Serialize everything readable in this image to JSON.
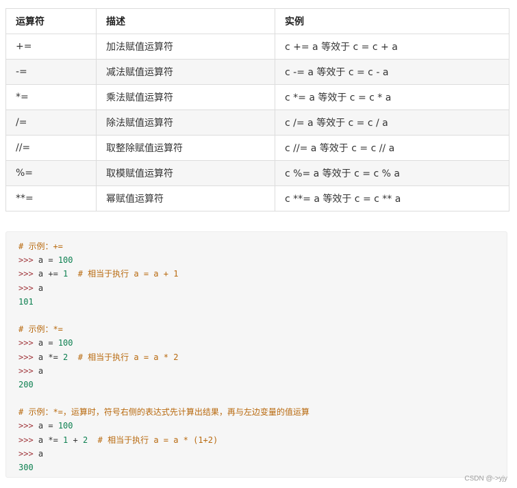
{
  "table": {
    "headers": [
      "运算符",
      "描述",
      "实例"
    ],
    "rows": [
      [
        "+=",
        "加法赋值运算符",
        "c += a 等效于 c = c + a"
      ],
      [
        "-=",
        "减法赋值运算符",
        "c -= a 等效于 c = c - a"
      ],
      [
        "*=",
        "乘法赋值运算符",
        "c *= a 等效于 c = c * a"
      ],
      [
        "/=",
        "除法赋值运算符",
        "c /= a 等效于 c = c / a"
      ],
      [
        "//=",
        "取整除赋值运算符",
        "c //= a 等效于 c = c // a"
      ],
      [
        "%=",
        "取模赋值运算符",
        "c %= a 等效于 c = c % a"
      ],
      [
        "**=",
        "幂赋值运算符",
        "c **= a 等效于 c = c ** a"
      ]
    ]
  },
  "code": {
    "lines": [
      [
        {
          "t": "cm",
          "v": "# 示例：+="
        }
      ],
      [
        {
          "t": "pr",
          "v": ">>> "
        },
        {
          "t": "tx",
          "v": "a = "
        },
        {
          "t": "num",
          "v": "100"
        }
      ],
      [
        {
          "t": "pr",
          "v": ">>> "
        },
        {
          "t": "tx",
          "v": "a += "
        },
        {
          "t": "num",
          "v": "1"
        },
        {
          "t": "tx",
          "v": "  "
        },
        {
          "t": "cm",
          "v": "# 相当于执行 a = a + 1"
        }
      ],
      [
        {
          "t": "pr",
          "v": ">>> "
        },
        {
          "t": "tx",
          "v": "a"
        }
      ],
      [
        {
          "t": "out",
          "v": "101"
        }
      ],
      [],
      [
        {
          "t": "cm",
          "v": "# 示例：*="
        }
      ],
      [
        {
          "t": "pr",
          "v": ">>> "
        },
        {
          "t": "tx",
          "v": "a = "
        },
        {
          "t": "num",
          "v": "100"
        }
      ],
      [
        {
          "t": "pr",
          "v": ">>> "
        },
        {
          "t": "tx",
          "v": "a *= "
        },
        {
          "t": "num",
          "v": "2"
        },
        {
          "t": "tx",
          "v": "  "
        },
        {
          "t": "cm",
          "v": "# 相当于执行 a = a * 2"
        }
      ],
      [
        {
          "t": "pr",
          "v": ">>> "
        },
        {
          "t": "tx",
          "v": "a"
        }
      ],
      [
        {
          "t": "out",
          "v": "200"
        }
      ],
      [],
      [
        {
          "t": "cm",
          "v": "# 示例：*=，运算时，符号右侧的表达式先计算出结果，再与左边变量的值运算"
        }
      ],
      [
        {
          "t": "pr",
          "v": ">>> "
        },
        {
          "t": "tx",
          "v": "a = "
        },
        {
          "t": "num",
          "v": "100"
        }
      ],
      [
        {
          "t": "pr",
          "v": ">>> "
        },
        {
          "t": "tx",
          "v": "a *= "
        },
        {
          "t": "num",
          "v": "1"
        },
        {
          "t": "tx",
          "v": " + "
        },
        {
          "t": "num",
          "v": "2"
        },
        {
          "t": "tx",
          "v": "  "
        },
        {
          "t": "cm",
          "v": "# 相当于执行 a = a * (1+2)"
        }
      ],
      [
        {
          "t": "pr",
          "v": ">>> "
        },
        {
          "t": "tx",
          "v": "a"
        }
      ],
      [
        {
          "t": "out",
          "v": "300"
        }
      ]
    ]
  },
  "watermark": "CSDN @->yjy"
}
